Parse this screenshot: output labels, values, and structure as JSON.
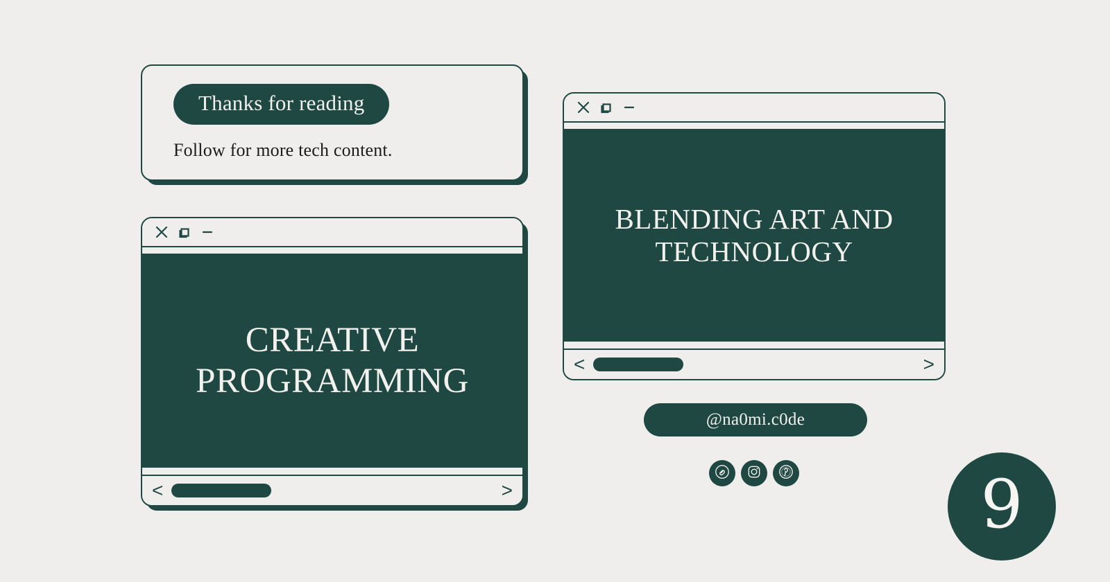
{
  "theme": {
    "background": "#efeeec",
    "accent_dark_green": "#1f4843",
    "text_light": "#f2f1ee",
    "text_dark": "#1b1b1b"
  },
  "thanks_card": {
    "pill_label": "Thanks for reading",
    "subtitle": "Follow for more tech content."
  },
  "windows": [
    {
      "id": "window-left",
      "headline": "CREATIVE PROGRAMMING",
      "controls": [
        {
          "name": "close-icon",
          "glyph": "X"
        },
        {
          "name": "restore-icon",
          "glyph": "square-layered"
        },
        {
          "name": "minimize-icon",
          "glyph": "—"
        }
      ],
      "scrollbar": {
        "left_arrow": "<",
        "right_arrow": ">",
        "thumb_percent": 31
      }
    },
    {
      "id": "window-right",
      "headline": "BLENDING ART AND TECHNOLOGY",
      "controls": [
        {
          "name": "close-icon",
          "glyph": "X"
        },
        {
          "name": "restore-icon",
          "glyph": "square-layered"
        },
        {
          "name": "minimize-icon",
          "glyph": "—"
        }
      ],
      "scrollbar": {
        "left_arrow": "<",
        "right_arrow": ">",
        "thumb_percent": 28
      }
    }
  ],
  "handle": {
    "label": "@na0mi.c0de"
  },
  "social": {
    "items": [
      {
        "name": "link-icon",
        "label": "link"
      },
      {
        "name": "instagram-icon",
        "label": "instagram"
      },
      {
        "name": "pinterest-icon",
        "label": "pinterest"
      }
    ]
  },
  "page_badge": {
    "number": "9"
  }
}
